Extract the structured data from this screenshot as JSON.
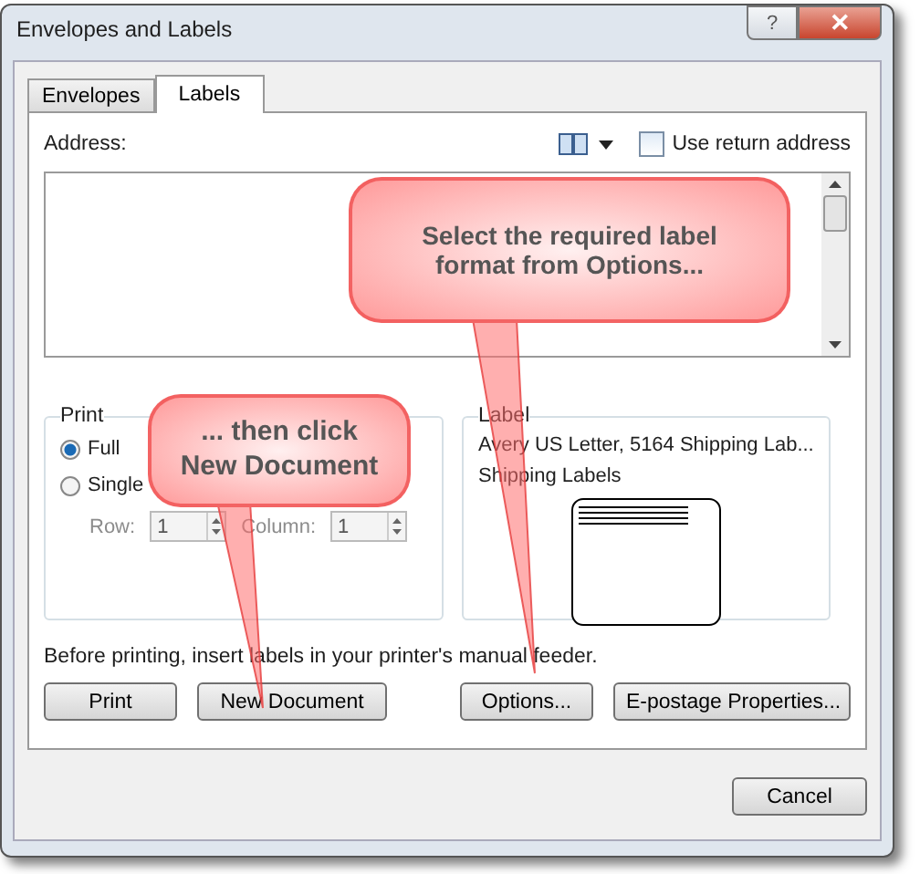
{
  "window": {
    "title": "Envelopes and Labels",
    "help": "?",
    "close": "✕"
  },
  "tabs": [
    {
      "label": "Envelopes",
      "selected": false
    },
    {
      "label": "Labels",
      "selected": true
    }
  ],
  "address": {
    "label": "Address:",
    "use_return_address": {
      "label": "Use return address",
      "checked": false
    }
  },
  "print_group": {
    "title": "Print",
    "options": [
      {
        "label": "Full",
        "selected": true
      },
      {
        "label": "Single",
        "selected": false
      }
    ],
    "row": {
      "label": "Row:",
      "value": "1",
      "disabled": true
    },
    "column": {
      "label": "Column:",
      "value": "1",
      "disabled": true
    }
  },
  "label_group": {
    "title": "Label",
    "name": "Avery US Letter, 5164 Shipping Lab...",
    "type": "Shipping Labels"
  },
  "note": "Before printing, insert labels in your printer's manual feeder.",
  "buttons": [
    "Print",
    "New Document",
    "Options...",
    "E-postage Properties..."
  ],
  "cancel": "Cancel",
  "callouts": [
    {
      "text": "Select the required label format from Options..."
    },
    {
      "text": "... then click New Document"
    }
  ]
}
